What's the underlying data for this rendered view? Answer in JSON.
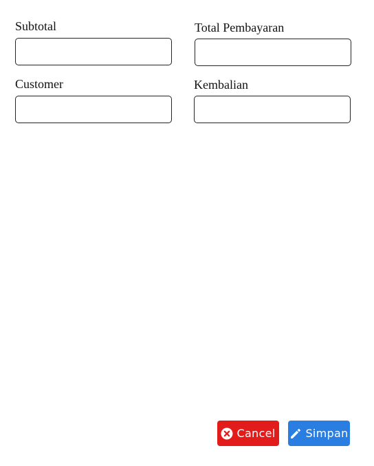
{
  "form": {
    "subtotal": {
      "label": "Subtotal",
      "value": "",
      "placeholder": ""
    },
    "total_pembayaran": {
      "label": "Total Pembayaran",
      "value": "",
      "placeholder": ""
    },
    "customer": {
      "label": "Customer",
      "value": "",
      "placeholder": ""
    },
    "kembalian": {
      "label": "Kembalian",
      "value": "",
      "placeholder": ""
    }
  },
  "actions": {
    "cancel": {
      "label": "Cancel",
      "icon": "close-circle-icon",
      "color": "#e21b1b"
    },
    "save": {
      "label": "Simpan",
      "icon": "pencil-icon",
      "color": "#2a7de1"
    }
  }
}
